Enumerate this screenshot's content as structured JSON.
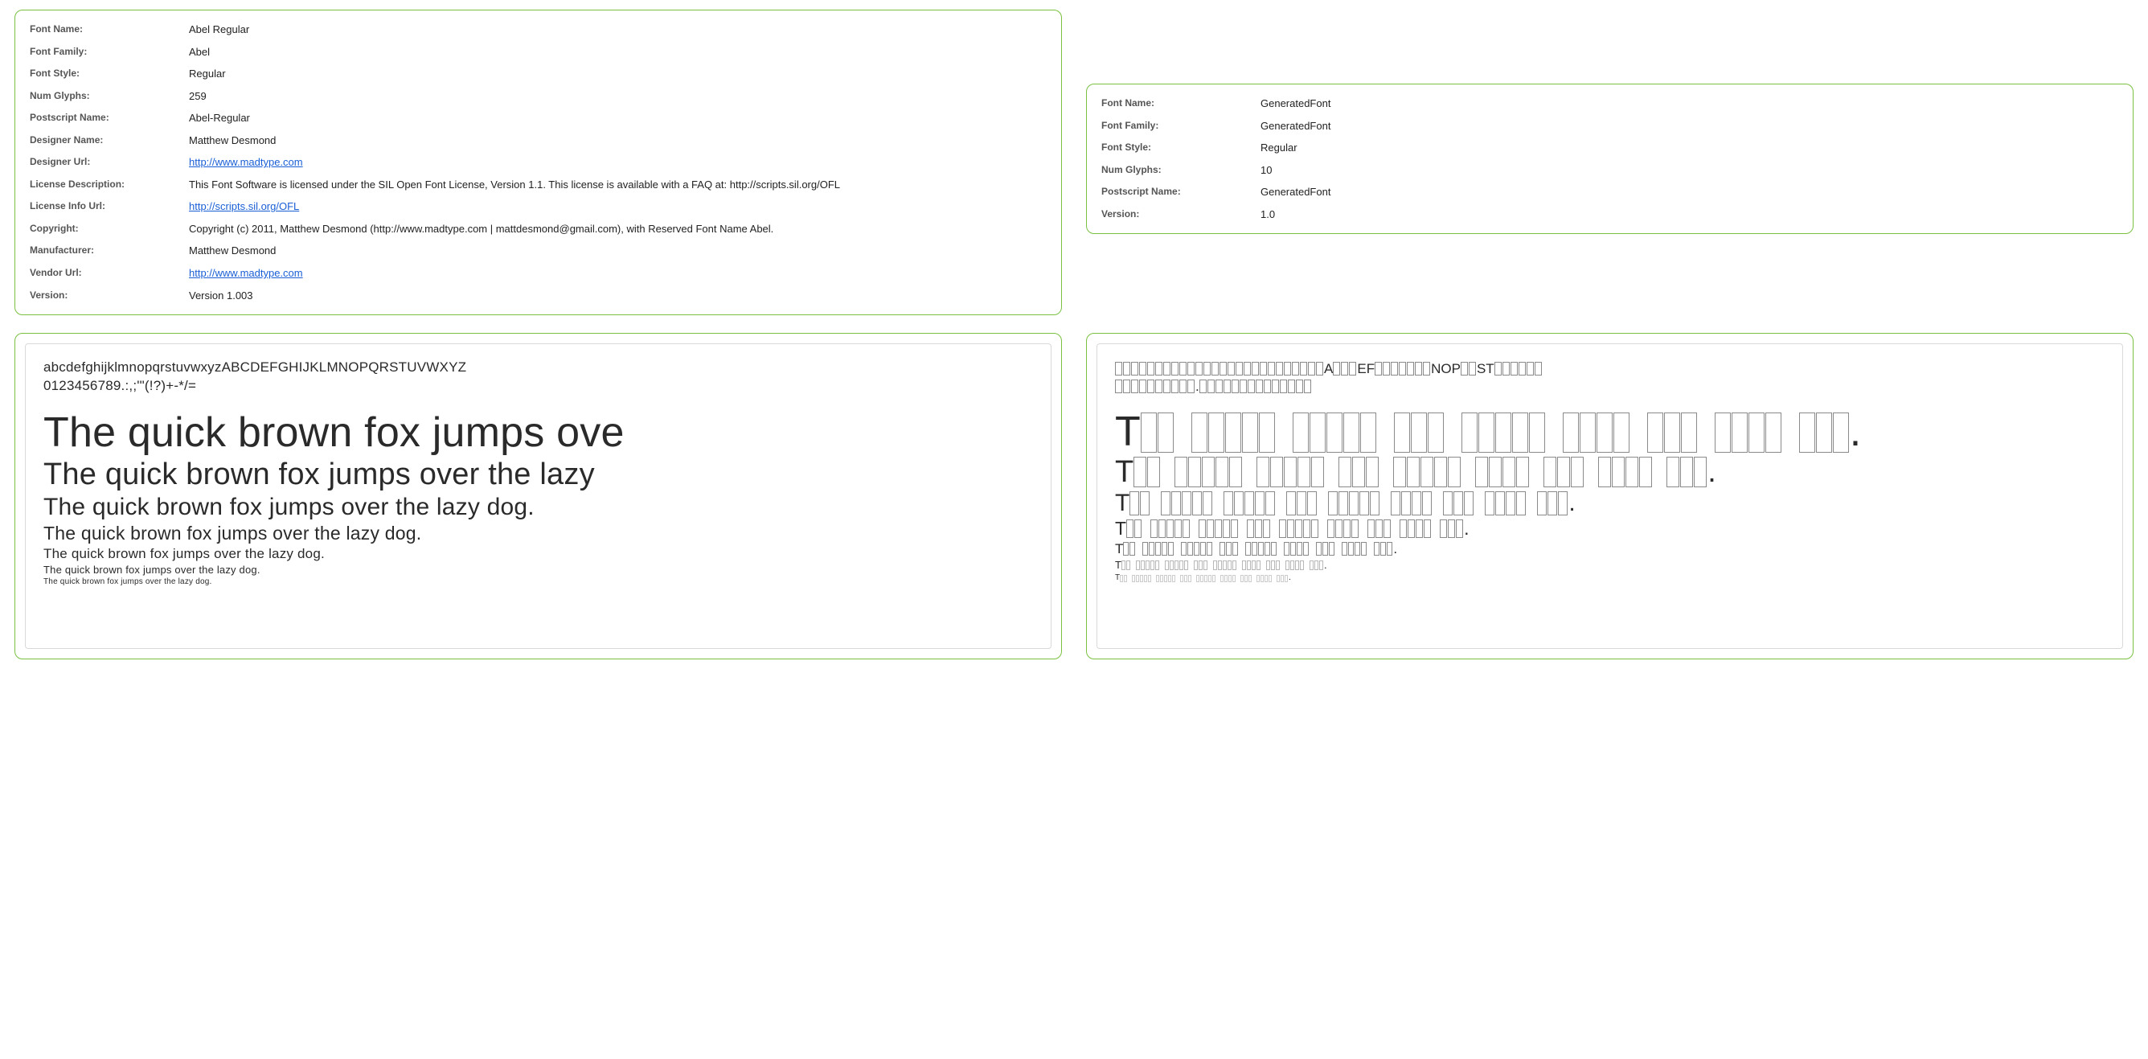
{
  "left": {
    "info": {
      "fontName": {
        "label": "Font Name:",
        "value": "Abel Regular"
      },
      "fontFamily": {
        "label": "Font Family:",
        "value": "Abel"
      },
      "fontStyle": {
        "label": "Font Style:",
        "value": "Regular"
      },
      "numGlyphs": {
        "label": "Num Glyphs:",
        "value": "259"
      },
      "postscriptName": {
        "label": "Postscript Name:",
        "value": "Abel-Regular"
      },
      "designerName": {
        "label": "Designer Name:",
        "value": "Matthew Desmond"
      },
      "designerUrl": {
        "label": "Designer Url:",
        "value": "http://www.madtype.com"
      },
      "licenseDescription": {
        "label": "License Description:",
        "value": "This Font Software is licensed under the SIL Open Font License, Version 1.1. This license is available with a FAQ at: http://scripts.sil.org/OFL"
      },
      "licenseInfoUrl": {
        "label": "License Info Url:",
        "value": "http://scripts.sil.org/OFL"
      },
      "copyright": {
        "label": "Copyright:",
        "value": "Copyright (c) 2011, Matthew Desmond (http://www.madtype.com | mattdesmond@gmail.com), with Reserved Font Name Abel."
      },
      "manufacturer": {
        "label": "Manufacturer:",
        "value": "Matthew Desmond"
      },
      "vendorUrl": {
        "label": "Vendor Url:",
        "value": "http://www.madtype.com"
      },
      "version": {
        "label": "Version:",
        "value": "Version 1.003"
      }
    },
    "preview": {
      "charset": "abcdefghijklmnopqrstuvwxyzABCDEFGHIJKLMNOPQRSTUVWXYZ\n0123456789.:,;'\"(!?)+-*/=",
      "samples": [
        "The quick brown fox jumps ove",
        "The quick brown fox jumps over the lazy",
        "The quick brown fox jumps over the lazy dog.",
        "The quick brown fox jumps over the lazy dog.",
        "The quick brown fox jumps over the lazy dog.",
        "The quick brown fox jumps over the lazy dog.",
        "The quick brown fox jumps over the lazy dog."
      ]
    }
  },
  "right": {
    "info": {
      "fontName": {
        "label": "Font Name:",
        "value": "GeneratedFont"
      },
      "fontFamily": {
        "label": "Font Family:",
        "value": "GeneratedFont"
      },
      "fontStyle": {
        "label": "Font Style:",
        "value": "Regular"
      },
      "numGlyphs": {
        "label": "Num Glyphs:",
        "value": "10"
      },
      "postscriptName": {
        "label": "Postscript Name:",
        "value": "GeneratedFont"
      },
      "version": {
        "label": "Version:",
        "value": "1.0"
      }
    },
    "preview": {
      "available_glyphs": [
        "A",
        "E",
        "F",
        "N",
        "O",
        "P",
        "S",
        "T",
        ".",
        " "
      ],
      "charset_line1": "abcdefghijklmnopqrstuvwxyzABCDEFGHIJKLMNOPQRSTUVWXYZ",
      "charset_line2": "0123456789.:,;'\"(!?)+-*/=",
      "sample_text": "The quick brown fox jumps over the lazy dog.",
      "sample_sizes": [
        52,
        38,
        30,
        23,
        17,
        13,
        10
      ]
    }
  }
}
